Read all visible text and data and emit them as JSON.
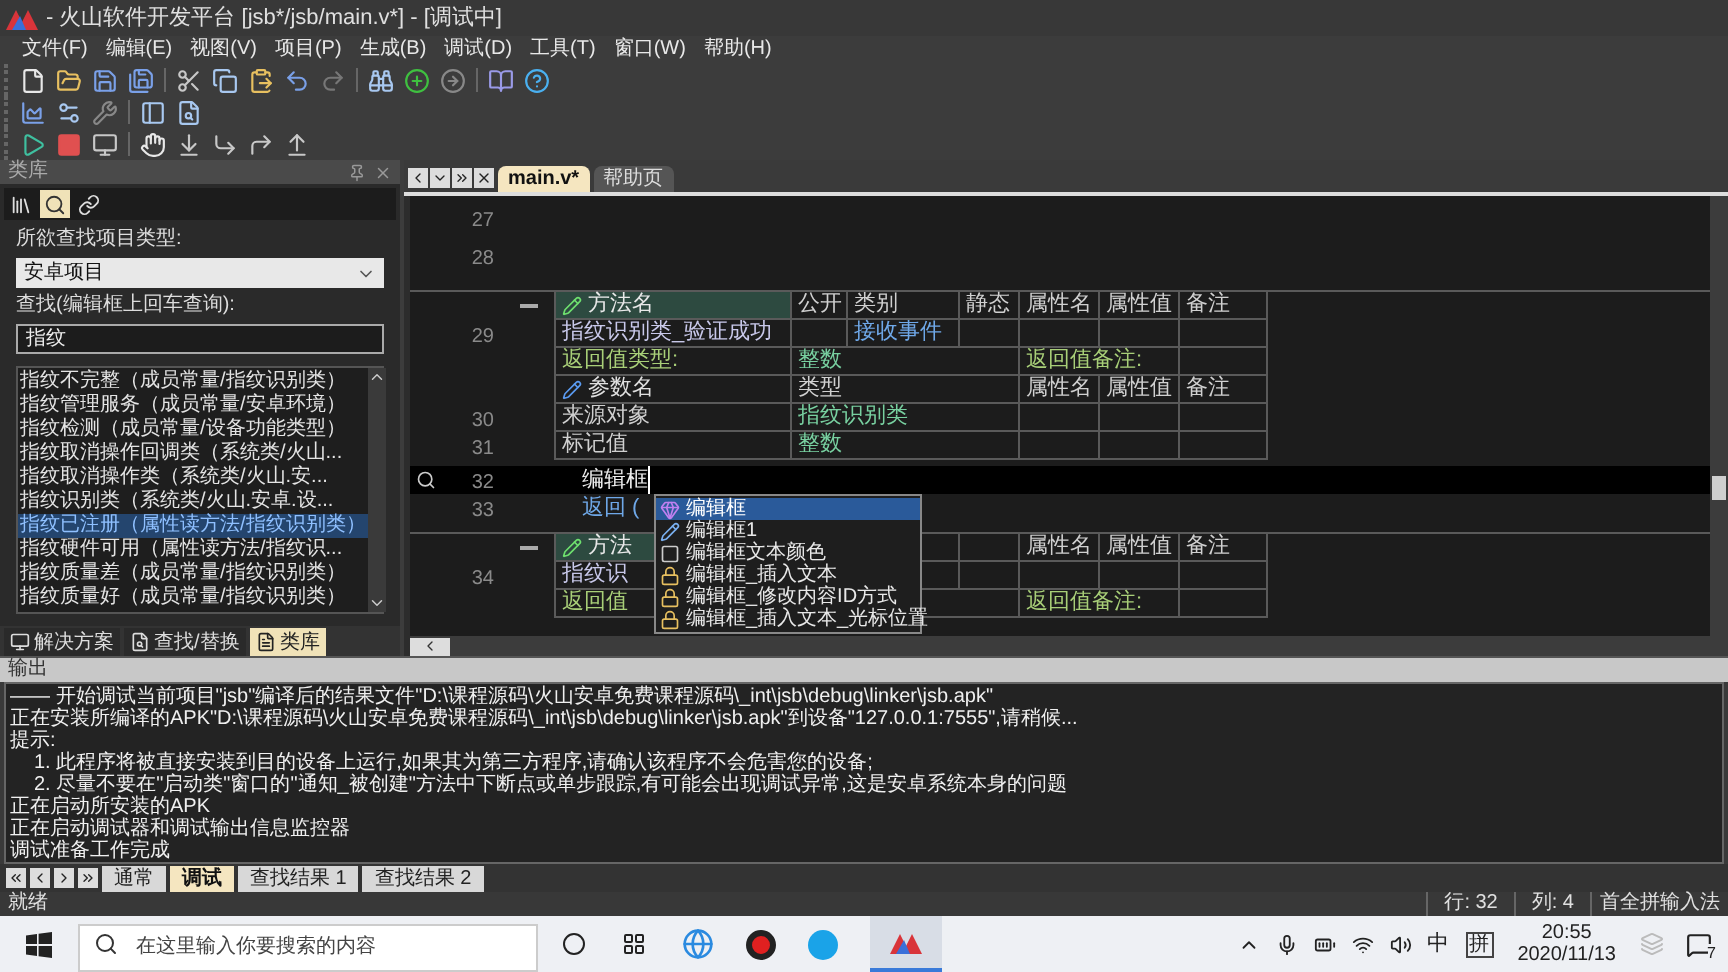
{
  "window": {
    "title": "- 火山软件开发平台 [jsb*/jsb/main.v*] - [调试中]"
  },
  "menu": [
    "文件(F)",
    "编辑(E)",
    "视图(V)",
    "项目(P)",
    "生成(B)",
    "调试(D)",
    "工具(T)",
    "窗口(W)",
    "帮助(H)"
  ],
  "left_panel": {
    "title": "类库",
    "icon_tabs": [
      {
        "kind": "class",
        "selected": false
      },
      {
        "kind": "search",
        "selected": true
      },
      {
        "kind": "link",
        "selected": false
      }
    ],
    "type_label": "所欲查找项目类型:",
    "type_select": "安卓项目",
    "search_label": "查找(编辑框上回车查询):",
    "search_value": "指纹",
    "results": [
      {
        "text": "指纹不完整（成员常量/指纹识别类）",
        "selected": false
      },
      {
        "text": "指纹管理服务（成员常量/安卓环境）",
        "selected": false
      },
      {
        "text": "指纹检测（成员常量/设备功能类型）",
        "selected": false
      },
      {
        "text": "指纹取消操作回调类（系统类/火山...",
        "selected": false
      },
      {
        "text": "指纹取消操作类（系统类/火山.安...",
        "selected": false
      },
      {
        "text": "指纹识别类（系统类/火山.安卓.设...",
        "selected": false
      },
      {
        "text": "指纹已注册（属性读方法/指纹识别类）",
        "selected": true
      },
      {
        "text": "指纹硬件可用（属性读方法/指纹识...",
        "selected": false
      },
      {
        "text": "指纹质量差（成员常量/指纹识别类）",
        "selected": false
      },
      {
        "text": "指纹质量好（成员常量/指纹识别类）",
        "selected": false
      }
    ],
    "bottom_tabs": [
      {
        "label": "解决方案",
        "kind": "solution",
        "selected": false
      },
      {
        "label": "查找/替换",
        "kind": "search",
        "selected": false
      },
      {
        "label": "类库",
        "kind": "library",
        "selected": true
      }
    ]
  },
  "editor": {
    "tabs": [
      {
        "label": "main.v*",
        "selected": true
      },
      {
        "label": "帮助页",
        "selected": false
      }
    ],
    "lines": [
      {
        "kind": "blank",
        "number": "27"
      },
      {
        "kind": "blank",
        "number": "28"
      },
      {
        "kind": "table",
        "rows": [
          {
            "kind": "method_header",
            "name": "方法名",
            "columns": [
              "公开",
              "类别",
              "静态",
              "属性名",
              "属性值",
              "备注"
            ]
          },
          {
            "kind": "method",
            "number": "29",
            "name": "指纹识别类_验证成功",
            "category": "接收事件"
          },
          {
            "kind": "return",
            "label": "返回值类型:",
            "type": "整数",
            "note_label": "返回值备注:"
          },
          {
            "kind": "param_header",
            "name": "参数名",
            "columns": [
              "类型",
              "属性名",
              "属性值",
              "备注"
            ]
          },
          {
            "kind": "param",
            "number": "30",
            "name": "来源对象",
            "type": "指纹识别类"
          },
          {
            "kind": "param",
            "number": "31",
            "name": "标记值",
            "type": "整数"
          }
        ]
      },
      {
        "kind": "code",
        "number": "32",
        "text": "编辑框",
        "current": true
      },
      {
        "kind": "code",
        "number": "33",
        "text": "返回 (",
        "current": false
      },
      {
        "kind": "table",
        "rows": [
          {
            "kind": "method_header",
            "name": "方法",
            "columns": [
              "属性名",
              "属性值",
              "备注"
            ]
          },
          {
            "kind": "method",
            "number": "34",
            "name": "指纹识"
          },
          {
            "kind": "return",
            "label": "返回值",
            "note_label": "返回值备注:"
          }
        ]
      }
    ],
    "completion": [
      {
        "label": "编辑框",
        "kind": "class",
        "selected": true
      },
      {
        "label": "编辑框1",
        "kind": "variable",
        "selected": false
      },
      {
        "label": "编辑框文本颜色",
        "kind": "property",
        "selected": false
      },
      {
        "label": "编辑框_插入文本",
        "kind": "method",
        "selected": false
      },
      {
        "label": "编辑框_修改内容ID方式",
        "kind": "method",
        "selected": false
      },
      {
        "label": "编辑框_插入文本_光标位置",
        "kind": "method",
        "selected": false
      }
    ]
  },
  "output": {
    "title": "输出",
    "lines": [
      {
        "text": "—— 开始调试当前项目\"jsb\"编译后的结果文件\"D:\\课程源码\\火山安卓免费课程源码\\_int\\jsb\\debug\\linker\\jsb.apk\"",
        "indented": false
      },
      {
        "text": "正在安装所编译的APK\"D:\\课程源码\\火山安卓免费课程源码\\_int\\jsb\\debug\\linker\\jsb.apk\"到设备\"127.0.0.1:7555\",请稍候...",
        "indented": false
      },
      {
        "text": "提示:",
        "indented": false
      },
      {
        "text": "1. 此程序将被直接安装到目的设备上运行,如果其为第三方程序,请确认该程序不会危害您的设备;",
        "indented": true
      },
      {
        "text": "2. 尽量不要在\"启动类\"窗口的\"通知_被创建\"方法中下断点或单步跟踪,有可能会出现调试异常,这是安卓系统本身的问题",
        "indented": true
      },
      {
        "text": "正在启动所安装的APK",
        "indented": false
      },
      {
        "text": "正在启动调试器和调试输出信息监控器",
        "indented": false
      },
      {
        "text": "调试准备工作完成",
        "indented": false
      }
    ],
    "tabs": [
      {
        "label": "通常",
        "selected": false
      },
      {
        "label": "调试",
        "selected": true
      },
      {
        "label": "查找结果 1",
        "selected": false
      },
      {
        "label": "查找结果 2",
        "selected": false
      }
    ]
  },
  "status_bar": {
    "message": "就绪",
    "row": "行: 32",
    "column": "列: 4",
    "ime": "首全拼输入法"
  },
  "taskbar": {
    "search_placeholder": "在这里输入你要搜索的内容",
    "input_mode": "中",
    "ime": "拼",
    "time": "20:55",
    "date": "2020/11/13",
    "notifications": "7"
  }
}
